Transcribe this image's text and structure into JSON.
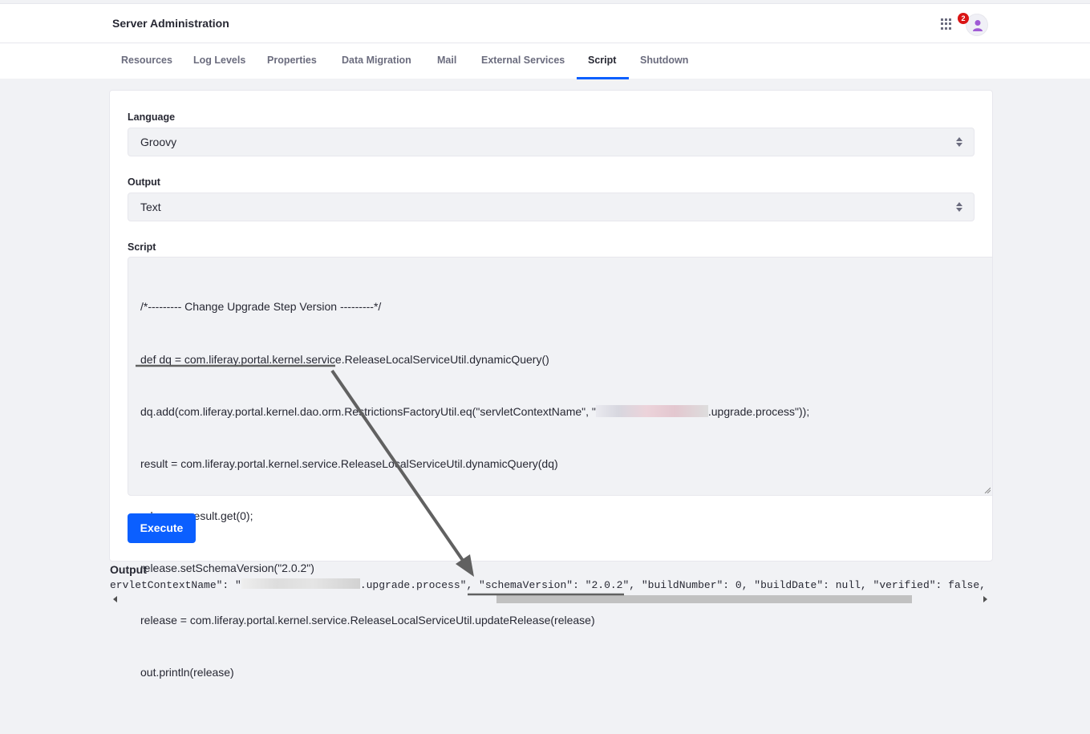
{
  "header": {
    "title": "Server Administration",
    "notification_count": "2",
    "icons": [
      "apps-grid-icon",
      "user-avatar-icon"
    ]
  },
  "tabs": [
    {
      "label": "Resources"
    },
    {
      "label": "Log Levels"
    },
    {
      "label": "Properties"
    },
    {
      "label": "Data Migration"
    },
    {
      "label": "Mail"
    },
    {
      "label": "External Services"
    },
    {
      "label": "Script"
    },
    {
      "label": "Shutdown"
    }
  ],
  "active_tab": "Script",
  "form": {
    "language_label": "Language",
    "language_value": "Groovy",
    "output_label": "Output",
    "output_value": "Text",
    "script_label": "Script",
    "script_lines": [
      "/*--------- Change Upgrade Step Version ---------*/",
      "def dq = com.liferay.portal.kernel.service.ReleaseLocalServiceUtil.dynamicQuery()",
      "dq.add(com.liferay.portal.kernel.dao.orm.RestrictionsFactoryUtil.eq(\"servletContextName\", \"",
      ".upgrade.process\"));",
      "result = com.liferay.portal.kernel.service.ReleaseLocalServiceUtil.dynamicQuery(dq)",
      "release = result.get(0);",
      "release.setSchemaVersion(\"2.0.2\")",
      "release = com.liferay.portal.kernel.service.ReleaseLocalServiceUtil.updateRelease(release)",
      "out.println(release)"
    ],
    "execute_label": "Execute"
  },
  "output": {
    "title": "Output",
    "text_prefix": "ervletContextName\": \"",
    "text_suffix": ".upgrade.process\", \"schemaVersion\": \"2.0.2\", \"buildNumber\": 0, \"buildDate\": null, \"verified\": false, \"stat"
  },
  "colors": {
    "accent": "#0b5fff",
    "badge": "#da1414",
    "annotation": "#616161"
  }
}
